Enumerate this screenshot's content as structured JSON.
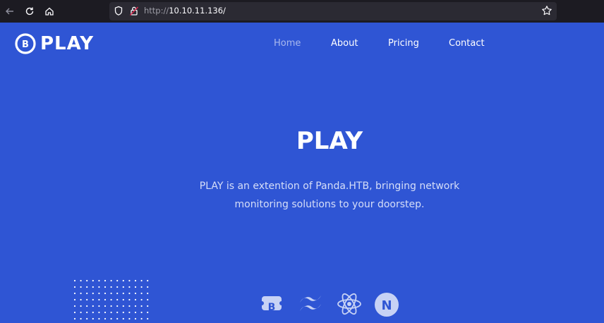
{
  "browser": {
    "url_protocol": "http://",
    "url_host": "10.10.11.136/",
    "icons": [
      "back-arrow-icon",
      "reload-icon",
      "home-icon",
      "shield-icon",
      "lock-icon",
      "star-icon"
    ]
  },
  "site": {
    "logo_letter": "B",
    "logo_text": "PLAY"
  },
  "nav": {
    "items": [
      {
        "label": "Home",
        "active": true
      },
      {
        "label": "About",
        "active": false
      },
      {
        "label": "Pricing",
        "active": false
      },
      {
        "label": "Contact",
        "active": false
      }
    ]
  },
  "hero": {
    "title": "PLAY",
    "description_line1": "PLAY is an extention of Panda.HTB, bringing network",
    "description_line2": "monitoring solutions to your doorstep."
  },
  "tech": {
    "icons": [
      "bootstrap-icon",
      "tailwind-icon",
      "react-icon",
      "nextjs-icon"
    ],
    "next_letter": "N",
    "bootstrap_letter": "B"
  },
  "colors": {
    "page_bg": "#2f55d4",
    "nav_active": "#a9b9ee",
    "chrome_bg": "#1c1b22",
    "urlbar_bg": "#2b2a33"
  }
}
